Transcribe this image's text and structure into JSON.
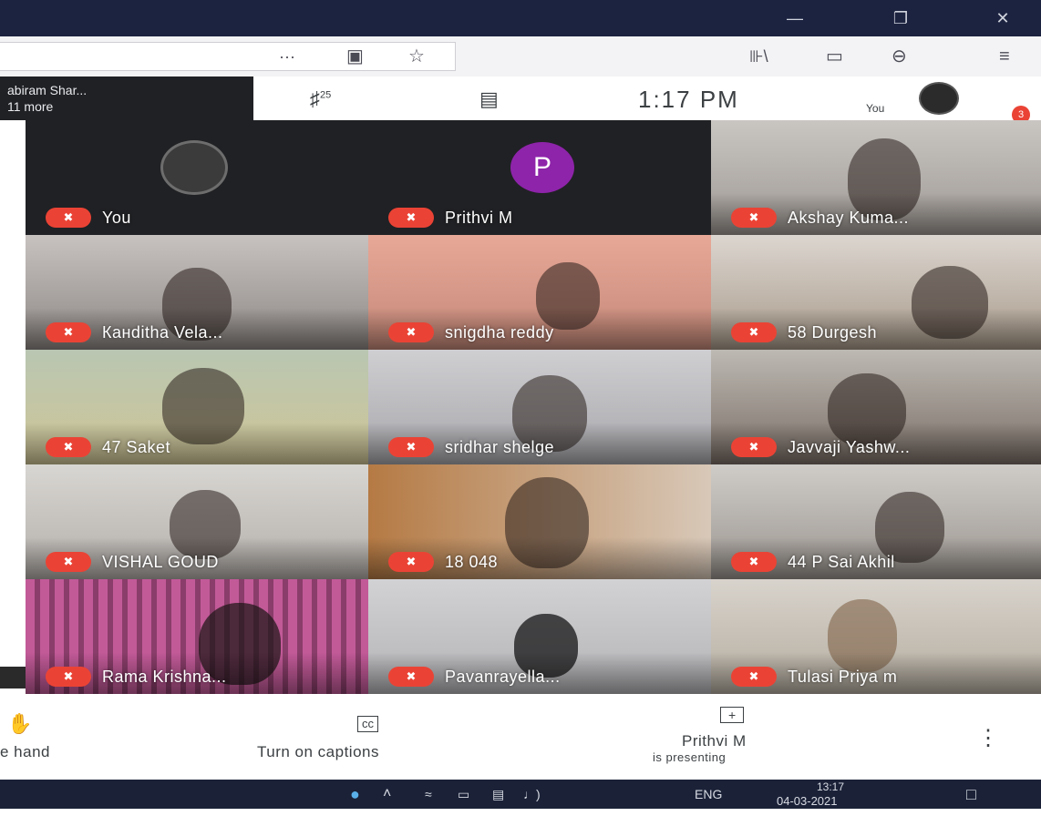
{
  "window": {
    "minimize": "—",
    "restore": "❐",
    "close": "✕"
  },
  "toolbar": {
    "more": "···",
    "pocket": "▣",
    "star": "☆",
    "library": "⊪\\",
    "reader": "▭",
    "account": "⊖",
    "menu": "≡"
  },
  "meet": {
    "presenters_line1": "abiram Shar...",
    "presenters_line2": "11 more",
    "participants_count": "25",
    "clock": "1:17  PM",
    "you_label": "You",
    "notif_badge": "3"
  },
  "participants": [
    {
      "name": "You"
    },
    {
      "name": "Prithvi M",
      "initial": "P"
    },
    {
      "name": "Akshay Kuma..."
    },
    {
      "name": "Канditha Vela..."
    },
    {
      "name": "snigdha reddy"
    },
    {
      "name": "58 Durgesh"
    },
    {
      "name": "47 Saket"
    },
    {
      "name": "sridhar shelge"
    },
    {
      "name": "Javvaji Yashw..."
    },
    {
      "name": "VISHAL GOUD"
    },
    {
      "name": "18 048"
    },
    {
      "name": "44 P Sai Akhil"
    },
    {
      "name": "Rama Krishna..."
    },
    {
      "name": "Pavanrayella..."
    },
    {
      "name": "Tulasi Priya m"
    }
  ],
  "controls": {
    "raise_hand": "e hand",
    "captions": "Turn on captions",
    "captions_icon": "cc",
    "presenting_name": "Prithvi M",
    "presenting_sub": "is presenting",
    "more": "⋮"
  },
  "taskbar": {
    "lang": "ENG",
    "time": "13:17",
    "date": "04-03-2021"
  },
  "colors": {
    "accent_red": "#ea4335",
    "avatar_purple": "#8e24aa",
    "tile_bg": "#202124"
  }
}
